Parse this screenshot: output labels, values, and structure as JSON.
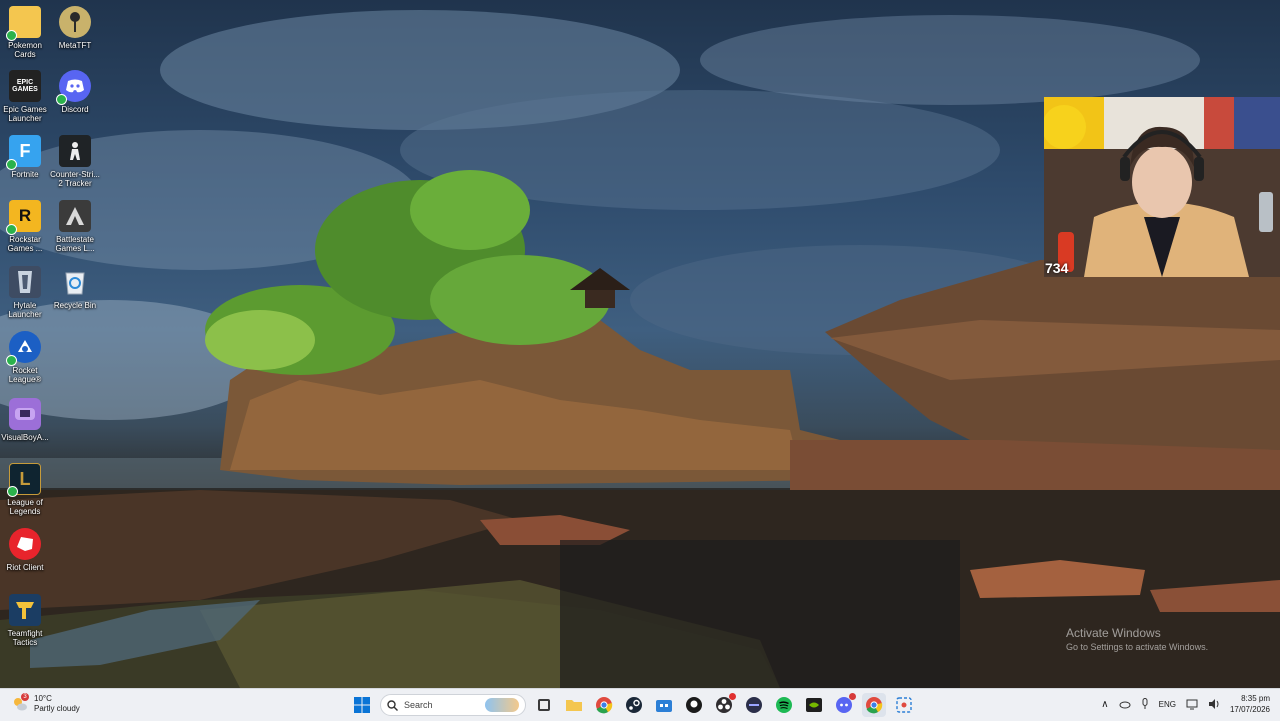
{
  "desktop_icons": [
    {
      "label": "Pokemon\nCards",
      "icon": "folder-icon"
    },
    {
      "label": "MetaTFT",
      "icon": "metatft-icon"
    },
    {
      "label": "Epic Games\nLauncher",
      "icon": "epic-games-icon",
      "badge": "EPIC\nGAMES"
    },
    {
      "label": "Discord",
      "icon": "discord-icon"
    },
    {
      "label": "Fortnite",
      "icon": "fortnite-icon",
      "badge": "F"
    },
    {
      "label": "Counter-Stri...\n2 Tracker",
      "icon": "cs2-tracker-icon"
    },
    {
      "label": "Rockstar\nGames ...",
      "icon": "rockstar-icon",
      "badge": "R"
    },
    {
      "label": "Battlestate\nGames L...",
      "icon": "battlestate-icon"
    },
    {
      "label": "Hytale\nLauncher",
      "icon": "hytale-icon"
    },
    {
      "label": "Recycle Bin",
      "icon": "recycle-bin-icon"
    },
    {
      "label": "Rocket\nLeague®",
      "icon": "rocket-league-icon"
    },
    {
      "label": "VisualBoyA...",
      "icon": "visualboy-icon"
    },
    {
      "label": "League of\nLegends",
      "icon": "league-of-legends-icon"
    },
    {
      "label": "Riot Client",
      "icon": "riot-client-icon"
    },
    {
      "label": "Teamfight\nTactics",
      "icon": "teamfight-tactics-icon"
    }
  ],
  "webcam": {
    "counter": "734"
  },
  "watermark": {
    "title": "Activate Windows",
    "subtitle": "Go to Settings to activate Windows."
  },
  "taskbar": {
    "weather": {
      "temp": "10°C",
      "condition": "Partly cloudy",
      "alert_count": "3"
    },
    "search_placeholder": "Search",
    "apps": [
      "start-icon",
      "search",
      "widget-icon",
      "task-view-icon",
      "file-explorer-icon",
      "chrome-icon",
      "steam-icon",
      "store-icon",
      "github-icon",
      "obs-icon",
      "app-icon",
      "spotify-icon",
      "nvidia-icon",
      "discord-icon",
      "chrome-icon-2",
      "snipping-tool-icon"
    ],
    "tray": {
      "language": "ENG",
      "time": "8:35 pm",
      "date": "17/07/2026"
    }
  },
  "colors": {
    "taskbar_bg": "#eef0f4",
    "accent": "#0067c0"
  }
}
